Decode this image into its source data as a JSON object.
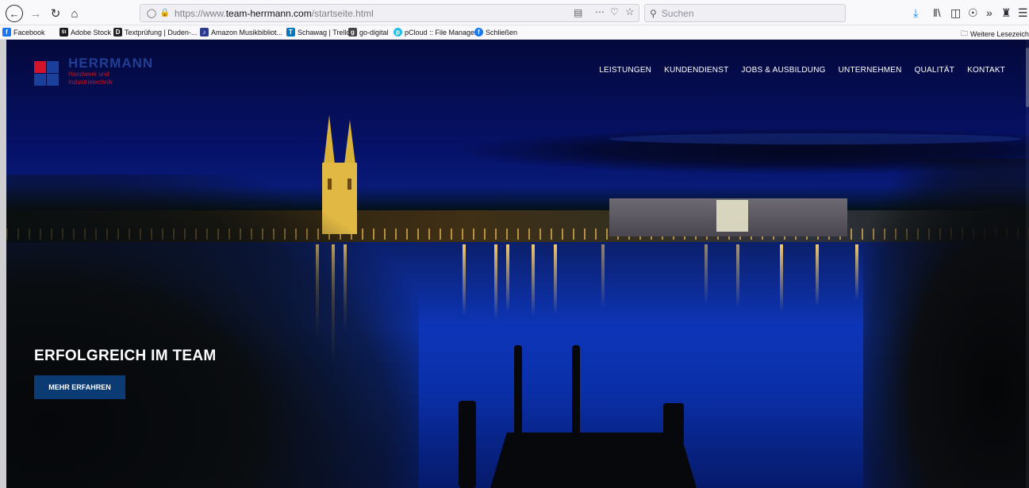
{
  "browser": {
    "back_icon": "arrow-left-icon",
    "forward_icon": "arrow-right-icon",
    "reload_icon": "reload-icon",
    "home_icon": "home-icon",
    "url_prefix": "https://www.",
    "url_domain": "team-herrmann.com",
    "url_path": "/startseite.html",
    "search_placeholder": "Suchen",
    "download_color": "#0a84ff"
  },
  "bookmarks": {
    "items": [
      {
        "label": "Facebook",
        "icon_color": "#1877f2",
        "icon_letter": "f"
      },
      {
        "label": "Adobe Stock",
        "icon_color": "#1a1a1a",
        "icon_letter": "St"
      },
      {
        "label": "Textprüfung | Duden-...",
        "icon_color": "#222222",
        "icon_letter": "D"
      },
      {
        "label": "Amazon Musikbibliot...",
        "icon_color": "#2c3a8f",
        "icon_letter": "♪"
      },
      {
        "label": "Schawag | Trello",
        "icon_color": "#0079bf",
        "icon_letter": "T"
      },
      {
        "label": "go-digital",
        "icon_color": "#444444",
        "icon_letter": "g"
      },
      {
        "label": "pCloud :: File Manager",
        "icon_color": "#20bfe3",
        "icon_letter": "p"
      },
      {
        "label": "Schließen",
        "icon_color": "#1877f2",
        "icon_letter": "f"
      }
    ],
    "other_label": "Weitere Lesezeichen"
  },
  "site": {
    "logo": {
      "brand": "HERRMANN",
      "tagline_1": "Handwerk und",
      "tagline_2": "Industrietechnik",
      "colors": {
        "red": "#d3132a",
        "blue": "#1a3f9c"
      }
    },
    "nav": [
      "LEISTUNGEN",
      "KUNDENDIENST",
      "JOBS & AUSBILDUNG",
      "UNTERNEHMEN",
      "QUALITÄT",
      "KONTAKT"
    ],
    "hero": {
      "headline": "ERFOLGREICH IM TEAM",
      "cta_label": "MEHR ERFAHREN",
      "cta_color": "#0c3a72"
    }
  }
}
